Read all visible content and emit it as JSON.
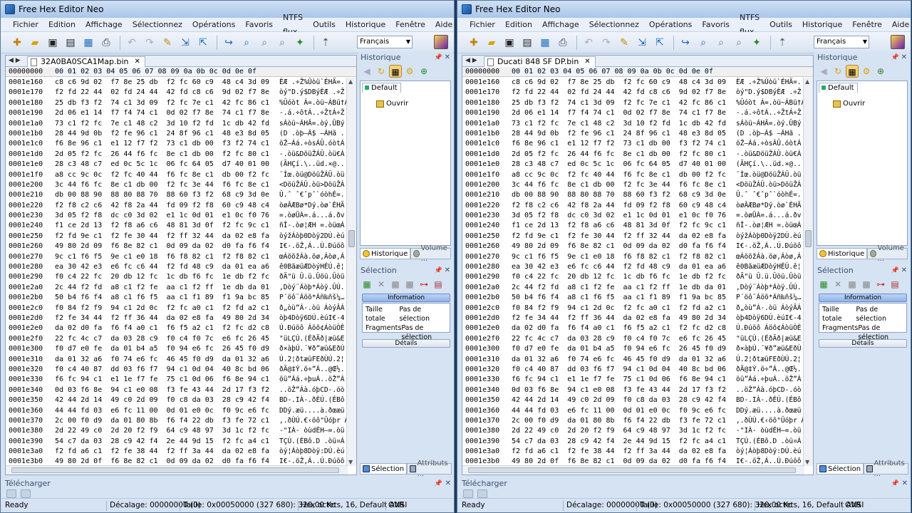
{
  "app_title": "Free Hex Editor Neo",
  "menu": [
    "Fichier",
    "Edition",
    "Affichage",
    "Sélectionnez",
    "Opérations",
    "Favoris",
    "NTFS flux",
    "Outils",
    "Historique",
    "Fenêtre",
    "Aide"
  ],
  "language": "Français",
  "header": {
    "offset_col": "00000000",
    "columns": "00 01 02 03 04 05 06 07 08 09 0a 0b 0c 0d 0e 0f"
  },
  "history_pane": {
    "title": "Historique",
    "tab": "Default",
    "item": "Ouvrir",
    "tabs": [
      "Historique",
      "Volume ..."
    ]
  },
  "selection_pane": {
    "title": "Sélection",
    "info_header": "Information",
    "rows": [
      {
        "label": "Taille totale",
        "value": "Pas de sélection"
      },
      {
        "label": "Fragments",
        "value": "Pas de sélection"
      }
    ],
    "details_header": "Détails",
    "tabs": [
      "Sélection",
      "Attributs ..."
    ]
  },
  "download_bar": "Télécharger",
  "status": {
    "ready": "Ready",
    "offset": "Décalage: 00000000 (0)",
    "size": "Taille: 0x00050000 (327 680): 320,00 Ko",
    "mode": "Hex octets, 16, Default ANSI",
    "ovr": "OVR"
  },
  "windows": [
    {
      "file_tab": "32A0BA0SCA1Map.bin",
      "rows": [
        {
          "off": "0001e160",
          "b": "c8 c6 9d 02  f7 8e 25 db  f2 fc 60 c9  48 c4 3d 09",
          "a": "ÈÆ .÷Ž%Ûòü`ÉHÄ=."
        },
        {
          "off": "0001e170",
          "b": "f2 fd 22 44  02 fd 24 44  42 fd c8 c6  9d 02 f7 8e",
          "a": "òý\"D.ý$DBýÈÆ .÷Ž"
        },
        {
          "off": "0001e180",
          "b": "25 db f3 f2  74 c1 3d 09  f2 fc 7e c1  42 fc 86 c1",
          "a": "%Ûóòt Á=.òü~ÁBü†Á"
        },
        {
          "off": "0001e190",
          "b": "2d 06 e1 14  f7 f4 74 c1  0d 02 f7 8e  74 c1 f7 8e",
          "a": "-.á.÷ôtÁ..÷ŽtÁ÷Ž"
        },
        {
          "off": "0001e1a0",
          "b": "73 c1 f2 fc  7e c1 48 c2  3d 10 f2 fd  1c db 42 fd",
          "a": "sÁòü~ÁHÂ=.òý.ÛBý"
        },
        {
          "off": "0001e1b0",
          "b": "28 44 9d 0b  f2 fe 96 c1  24 8f 96 c1  48 e3 8d 05",
          "a": "(D .òþ–Á$ –ÁHã ."
        },
        {
          "off": "0001e1c0",
          "b": "f6 8e 96 c1  e1 12 f7 f2  73 c1 db 00  f3 f2 74 c1",
          "a": "öŽ–Áá.÷òsÁÛ.óòtÁ"
        },
        {
          "off": "0001e1d0",
          "b": "2d 05 f2 fc  26 44 f6 fc  8e c1 db 00  f2 fc 80 c1",
          "a": "-.òü&DöüŽÁÛ.òü€Á"
        },
        {
          "off": "0001e1e0",
          "b": "28 c3 48 c7  ed 0c 5c 1c  06 fc 64 05  d7 40 01 00",
          "a": "(ÃHÇí.\\..üd.×@.."
        },
        {
          "off": "0001e1f0",
          "b": "a8 cc 9c 0c  f2 fc 40 44  f6 fc 8e c1  db 00 f2 fc",
          "a": "¨Ìœ.òü@DöüŽÁÛ.òü"
        },
        {
          "off": "0001e200",
          "b": "3c 44 f6 fc  8e c1 db 00  f2 fc 3e 44  f6 fc 8e c1",
          "a": "<DöüŽÁÛ.òü>DöüŽÁ"
        },
        {
          "off": "0001e210",
          "b": "db 00 88 90  88 80 88 70  88 60 f3 f2  68 c9 3d 0e",
          "a": "Û.ˆ ˆ€ˆpˆ`óòhÉ=."
        },
        {
          "off": "0001e220",
          "b": "f2 f8 c2 c6  42 f8 2a 44  fd 09 f2 f8  60 c9 48 c4",
          "a": "òøÂÆBø*Dý.òø`ÉHÄ"
        },
        {
          "off": "0001e230",
          "b": "3d 05 f2 f8  dc c0 3d 02  e1 1c 0d 01  e1 0c f0 76",
          "a": "=.òøÜÀ=.á...á.ðv"
        },
        {
          "off": "0001e240",
          "b": "f1 ce 2d 13  f2 f8 a6 c6  48 81 3d 0f  f2 fc 9c c1",
          "a": "ñÎ-.òø¦ÆH =.òüœÁ"
        },
        {
          "off": "0001e250",
          "b": "f2 fd 9e c1  f2 fe 30 44  f2 ff 32 44  da 02 e8 fa",
          "a": "òýžÁòþ0Dòÿ2DÚ.èú"
        },
        {
          "off": "0001e260",
          "b": "49 80 2d 09  f6 8e 82 c1  0d 09 da 02  d0 fa f6 f4",
          "a": "I€-.öŽ‚Á..Ú.Ðúöô"
        },
        {
          "off": "0001e270",
          "b": "9c c1 f6 f5  9e c1 e0 18  f6 f8 82 c1  f2 f8 82 c1",
          "a": "œÁöõžÁà.öø‚Áòø‚Á"
        },
        {
          "off": "0001e280",
          "b": "ea 30 42 e3  e6 fc c6 44  f2 fd 48 c9  da 01 ea a6",
          "a": "ê0BãæüÆDòýHÉÚ.ê¦"
        },
        {
          "off": "0001e290",
          "b": "f0 c4 22 fc  20 db 12 fc  1c db f6 fc  1e db f2 fc",
          "a": "ðÄ\"ü Û.ü.Ûöü.Ûòü"
        },
        {
          "off": "0001e2a0",
          "b": "2c 44 f2 fd  a8 c1 f2 fe  aa c1 f2 ff  1e db da 01",
          "a": ",Dòý¨Áòþ*Áòÿ.ÛÚ."
        },
        {
          "off": "0001e2b0",
          "b": "50 b4 f6 f4  a8 c1 f6 f5  aa c1 f1 89  f1 9a bc 85",
          "a": "P´öô¨Áöõ*Áñ‰ñš¼…"
        },
        {
          "off": "0001e2c0",
          "b": "f0 84 f2 f9  94 c1 2d 0c  f2 fc a0 c1  f2 fd a2 c1",
          "a": "ð„òù”Á-.òü ÁòýÂÁ"
        },
        {
          "off": "0001e2d0",
          "b": "f2 fe 34 44  f2 ff 36 44  da 02 e8 fa  49 80 2d 34",
          "a": "òþ4Dòÿ6DÚ.èúI€-4"
        },
        {
          "off": "0001e2e0",
          "b": "da 02 d0 fa  f6 f4 a0 c1  f6 f5 a2 c1  f2 fc d2 c8",
          "a": "Ú.Ðúöô Áöõ¢ÁòüÒÈ"
        },
        {
          "off": "0001e2f0",
          "b": "22 fc 4c c7  da 03 28 c9  f0 c4 f0 7c  e6 fc 26 45",
          "a": "\"üLÇÚ.(ÉðÄð|æü&E"
        },
        {
          "off": "0001e300",
          "b": "f0 d7 e0 fe  da 01 b4 a5  f0 94 e6 fc  26 45 f0 d9",
          "a": "ð×àþÚ.´¥ð”æü&EðÙ"
        },
        {
          "off": "0001e310",
          "b": "da 01 32 a6  f0 74 e6 fc  46 45 f0 d9  da 01 32 a6",
          "a": "Ú.2¦ðtæüFEðÙÚ.2¦"
        },
        {
          "off": "0001e320",
          "b": "f0 c4 40 87  dd 03 f6 f7  94 c1 0d 04  40 8c bd 06",
          "a": "ðÄ@‡Ý.ö÷”Á..@Œ½."
        },
        {
          "off": "0001e330",
          "b": "f6 fc 94 c1  e1 1e f7 fe  75 c1 0d 06  f6 8e 94 c1",
          "a": "öü”Áá.÷þuÁ..öŽ”Á"
        },
        {
          "off": "0001e340",
          "b": "0d 03 f6 8e  94 c1 e0 08  f3 fe 43 44  2d 17 f3 f2",
          "a": "..öŽ”Áà.óþCD-.óò"
        },
        {
          "off": "0001e350",
          "b": "42 44 2d 14  49 c0 2d 09  f0 c8 da 03  28 c9 42 f4",
          "a": "BD-.IÀ-.ðÈÚ.(ÉBô"
        },
        {
          "off": "0001e360",
          "b": "44 44 fd 03  e6 fc 11 00  0d 01 e0 0c  f0 9c e6 fc",
          "a": "DDý.æü....à.ðœæü"
        },
        {
          "off": "0001e370",
          "b": "2c 00 f0 d9  da 01 80 8b  f6 f4 22 db  f3 fe 72 c1",
          "a": ",.ðÙÚ.€‹öô\"Ûóþr Á"
        },
        {
          "off": "0001e380",
          "b": "2d 22 49 c0  2d 20 f2 f9  64 c9 48 97  3d 1c f2 fc",
          "a": "-\"IÀ- òùdÉH—=.òü"
        },
        {
          "off": "0001e390",
          "b": "54 c7 da 03  28 c9 42 f4  2e 44 9d 15  f2 fc a4 c1",
          "a": "TÇÚ.(ÉBô.D .òü¤Á"
        },
        {
          "off": "0001e3a0",
          "b": "f2 fd a6 c1  f2 fe 38 44  f2 ff 3a 44  da 02 e8 fa",
          "a": "òý¦Áòþ8Dòÿ:DÚ.èú"
        },
        {
          "off": "0001e3b0",
          "b": "49 80 2d 0f  f6 8e 82 c1  0d 09 da 02  d0 fa f6 f4",
          "a": "I€-.öŽ‚Á..Ú.Ðúöô"
        }
      ]
    },
    {
      "file_tab": "Ducati 848 SF DP.bin",
      "rows": [
        {
          "off": "0001e160",
          "b": "c8 c6 9d 02  f7 8e 25 db  f2 fc 60 c9  48 c4 3d 09",
          "a": "ÈÆ .÷Ž%Ûòü`ÉHÄ=."
        },
        {
          "off": "0001e170",
          "b": "f2 fd 22 44  02 fd 24 44  42 fd c8 c6  9d 02 f7 8e",
          "a": "òý\"D.ý$DBýÈÆ .÷Ž"
        },
        {
          "off": "0001e180",
          "b": "25 db f3 f2  74 c1 3d 09  f2 fc 7e c1  42 fc 86 c1",
          "a": "%Ûóòt Á=.òü~ÁBü†Á"
        },
        {
          "off": "0001e190",
          "b": "2d 06 e1 14  f7 f4 74 c1  0d 02 f7 8e  74 c1 f7 8e",
          "a": "-.á.÷ôtÁ..÷ŽtÁ÷Ž"
        },
        {
          "off": "0001e1a0",
          "b": "73 c1 f2 fc  7e c1 48 c2  3d 10 f2 fd  1c db 42 fd",
          "a": "sÁòü~ÁHÂ=.òý.ÛBý"
        },
        {
          "off": "0001e1b0",
          "b": "28 44 9d 0b  f2 fe 96 c1  24 8f 96 c1  48 e3 8d 05",
          "a": "(D .òþ–Á$ –ÁHã ."
        },
        {
          "off": "0001e1c0",
          "b": "f6 8e 96 c1  e1 12 f7 f2  73 c1 db 00  f3 f2 74 c1",
          "a": "öŽ–Áá.÷òsÁÛ.óòtÁ"
        },
        {
          "off": "0001e1d0",
          "b": "2d 05 f2 fc  26 44 f6 fc  8e c1 db 00  f2 fc 80 c1",
          "a": "-.òü&DöüŽÁÛ.òü€Á"
        },
        {
          "off": "0001e1e0",
          "b": "28 c3 48 c7  ed 0c 5c 1c  06 fc 64 05  d7 40 01 00",
          "a": "(ÃHÇí.\\..üd.×@.."
        },
        {
          "off": "0001e1f0",
          "b": "a8 cc 9c 0c  f2 fc 40 44  f6 fc 8e c1  db 00 f2 fc",
          "a": "¨Ìœ.òü@DöüŽÁÛ.òü"
        },
        {
          "off": "0001e200",
          "b": "3c 44 f6 fc  8e c1 db 00  f2 fc 3e 44  f6 fc 8e c1",
          "a": "<DöüŽÁÛ.òü>DöüŽÁ"
        },
        {
          "off": "0001e210",
          "b": "db 00 88 90  88 80 88 70  88 60 f3 f2  68 c9 3d 0e",
          "a": "Û.ˆ ˆ€ˆpˆ`óòhÉ=."
        },
        {
          "off": "0001e220",
          "b": "f2 f8 c2 c6  42 f8 2a 44  fd 09 f2 f8  60 c9 48 c4",
          "a": "òøÂÆBø*Dý.òø`ÉHÄ"
        },
        {
          "off": "0001e230",
          "b": "3d 05 f2 f8  dc c0 3d 02  e1 1c 0d 01  e1 0c f0 76",
          "a": "=.òøÜÀ=.á...á.ðv"
        },
        {
          "off": "0001e240",
          "b": "f1 ce 2d 13  f2 f8 a6 c6  48 81 3d 0f  f2 fc 9c c1",
          "a": "ñÎ-.òø¦ÆH =.òüœÁ"
        },
        {
          "off": "0001e250",
          "b": "f2 fd 9e c1  f2 fe 30 44  f2 ff 32 44  da 02 e8 fa",
          "a": "òýžÁòþ0Dòÿ2DÚ.èú"
        },
        {
          "off": "0001e260",
          "b": "49 80 2d 09  f6 8e 82 c1  0d 09 da 02  d0 fa f6 f4",
          "a": "I€-.öŽ‚Á..Ú.Ðúöô"
        },
        {
          "off": "0001e270",
          "b": "9c c1 f6 f5  9e c1 e0 18  f6 f8 82 c1  f2 f8 82 c1",
          "a": "œÁöõžÁà.öø‚Áòø‚Á"
        },
        {
          "off": "0001e280",
          "b": "ea 30 42 e3  e6 fc c6 44  f2 fd 48 c9  da 01 ea a6",
          "a": "ê0BãæüÆDòýHÉÚ.ê¦"
        },
        {
          "off": "0001e290",
          "b": "f0 c4 22 fc  20 db 12 fc  1c db f6 fc  1e db f2 fc",
          "a": "ðÄ\"ü Û.ü.Ûöü.Ûòü"
        },
        {
          "off": "0001e2a0",
          "b": "2c 44 f2 fd  a8 c1 f2 fe  aa c1 f2 ff  1e db da 01",
          "a": ",Dòý¨Áòþ*Áòÿ.ÛÚ."
        },
        {
          "off": "0001e2b0",
          "b": "50 b4 f6 f4  a8 c1 f6 f5  aa c1 f1 89  f1 9a bc 85",
          "a": "P´öô¨Áöõ*Áñ‰ñš¼…"
        },
        {
          "off": "0001e2c0",
          "b": "f0 84 f2 f9  94 c1 2d 0c  f2 fc a0 c1  f2 fd a2 c1",
          "a": "ð„òù”Á-.òü ÁòýÂÁ"
        },
        {
          "off": "0001e2d0",
          "b": "f2 fe 34 44  f2 ff 36 44  da 02 e8 fa  49 80 2d 34",
          "a": "òþ4Dòÿ6DÚ.èúI€-4"
        },
        {
          "off": "0001e2e0",
          "b": "da 02 d0 fa  f6 f4 a0 c1  f6 f5 a2 c1  f2 fc d2 c8",
          "a": "Ú.Ðúöô Áöõ¢ÁòüÒÈ"
        },
        {
          "off": "0001e2f0",
          "b": "22 fc 4c c7  da 03 28 c9  f0 c4 f0 7c  e6 fc 26 45",
          "a": "\"üLÇÚ.(ÉðÄð|æü&E"
        },
        {
          "off": "0001e300",
          "b": "f0 d7 e0 fe  da 01 b4 a5  f0 94 e6 fc  26 45 f0 d9",
          "a": "ð×àþÚ.´¥ð”æü&EðÙ"
        },
        {
          "off": "0001e310",
          "b": "da 01 32 a6  f0 74 e6 fc  46 45 f0 d9  da 01 32 a6",
          "a": "Ú.2¦ðtæüFEðÙÚ.2¦"
        },
        {
          "off": "0001e320",
          "b": "f0 c4 40 87  dd 03 f6 f7  94 c1 0d 04  40 8c bd 06",
          "a": "ðÄ@‡Ý.ö÷”Á..@Œ½."
        },
        {
          "off": "0001e330",
          "b": "f6 fc 94 c1  e1 1e f7 fe  75 c1 0d 06  f6 8e 94 c1",
          "a": "öü”Áá.÷þuÁ..öŽ”Á"
        },
        {
          "off": "0001e340",
          "b": "0d 03 f6 8e  94 c1 e0 08  f3 fe 43 44  2d 17 f3 f2",
          "a": "..öŽ”Áà.óþCD-.óò"
        },
        {
          "off": "0001e350",
          "b": "42 44 2d 14  49 c0 2d 09  f0 c8 da 03  28 c9 42 f4",
          "a": "BD-.IÀ-.ðÈÚ.(ÉBô"
        },
        {
          "off": "0001e360",
          "b": "44 44 fd 03  e6 fc 11 00  0d 01 e0 0c  f0 9c e6 fc",
          "a": "DDý.æü....à.ðœæü"
        },
        {
          "off": "0001e370",
          "b": "2c 00 f0 d9  da 01 80 8b  f6 f4 22 db  f3 fe 72 c1",
          "a": ",.ðÙÚ.€‹öô\"Ûóþr Á"
        },
        {
          "off": "0001e380",
          "b": "2d 22 49 c0  2d 20 f2 f9  64 c9 48 97  3d 1c f2 fc",
          "a": "-\"IÀ- òùdÉH—=.òü"
        },
        {
          "off": "0001e390",
          "b": "54 c7 da 03  28 c9 42 f4  2e 44 9d 15  f2 fc a4 c1",
          "a": "TÇÚ.(ÉBô.D .òü¤Á"
        },
        {
          "off": "0001e3a0",
          "b": "f2 fd a6 c1  f2 fe 38 44  f2 ff 3a 44  da 02 e8 fa",
          "a": "òý¦Áòþ8Dòÿ:DÚ.èú"
        },
        {
          "off": "0001e3b0",
          "b": "49 80 2d 0f  f6 8e 82 c1  0d 09 da 02  d0 fa f6 f4",
          "a": "I€-.öŽ‚Á..Ú.Ðúöô"
        }
      ]
    }
  ]
}
